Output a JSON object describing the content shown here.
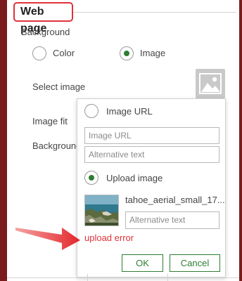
{
  "section": {
    "title": "Web page"
  },
  "background": {
    "label": "Background",
    "options": [
      {
        "label": "Color",
        "checked": false
      },
      {
        "label": "Image",
        "checked": true
      }
    ]
  },
  "settings": {
    "select_image_label": "Select image",
    "image_fit_label": "Image fit",
    "background_label": "Background"
  },
  "popup": {
    "image_url_option": {
      "label": "Image URL",
      "checked": false
    },
    "image_url_input": {
      "placeholder": "Image URL"
    },
    "alt_text_input": {
      "placeholder": "Alternative text"
    },
    "upload_option": {
      "label": "Upload image",
      "checked": true
    },
    "uploaded": {
      "filename": "tahoe_aerial_small_17...",
      "alt_placeholder": "Alternative text"
    },
    "error": "upload error",
    "ok_label": "OK",
    "cancel_label": "Cancel"
  },
  "colors": {
    "accent": "#2e7d32",
    "error": "#e0323a"
  },
  "icons": {
    "image_placeholder": "image-icon",
    "thumbnail": "tahoe-thumbnail-image",
    "pointer": "red-arrow"
  }
}
